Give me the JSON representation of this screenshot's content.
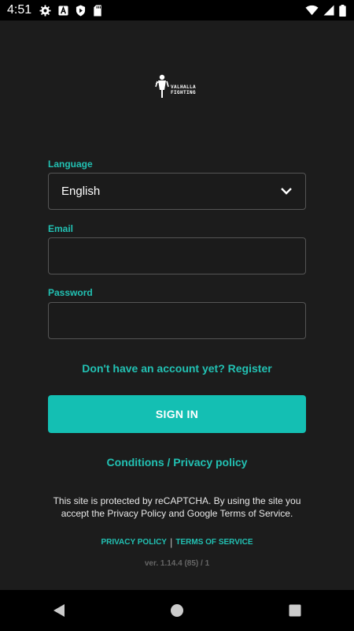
{
  "status_bar": {
    "time": "4:51",
    "icons": [
      "gear-icon",
      "a-box-icon",
      "shield-icon",
      "sd-card-icon"
    ],
    "right_icons": [
      "wifi-icon",
      "signal-icon",
      "battery-icon"
    ]
  },
  "logo": {
    "line1": "VALHALLA",
    "line2": "FIGHTING"
  },
  "form": {
    "language_label": "Language",
    "language_value": "English",
    "email_label": "Email",
    "email_value": "",
    "password_label": "Password",
    "password_value": ""
  },
  "register_link": "Don't have an account yet? Register",
  "sign_in_button": "SIGN IN",
  "conditions_link": "Conditions / Privacy policy",
  "recaptcha_notice": "This site is protected by reCAPTCHA. By using the site you accept the Privacy Policy and Google Terms of Service.",
  "legal": {
    "privacy_policy": "PRIVACY POLICY",
    "separator": "|",
    "terms_of_service": "TERMS OF SERVICE"
  },
  "version": "ver. 1.14.4 (85) / 1",
  "colors": {
    "accent": "#22c1b3",
    "button": "#14bfb3",
    "background": "#1c1c1c"
  }
}
